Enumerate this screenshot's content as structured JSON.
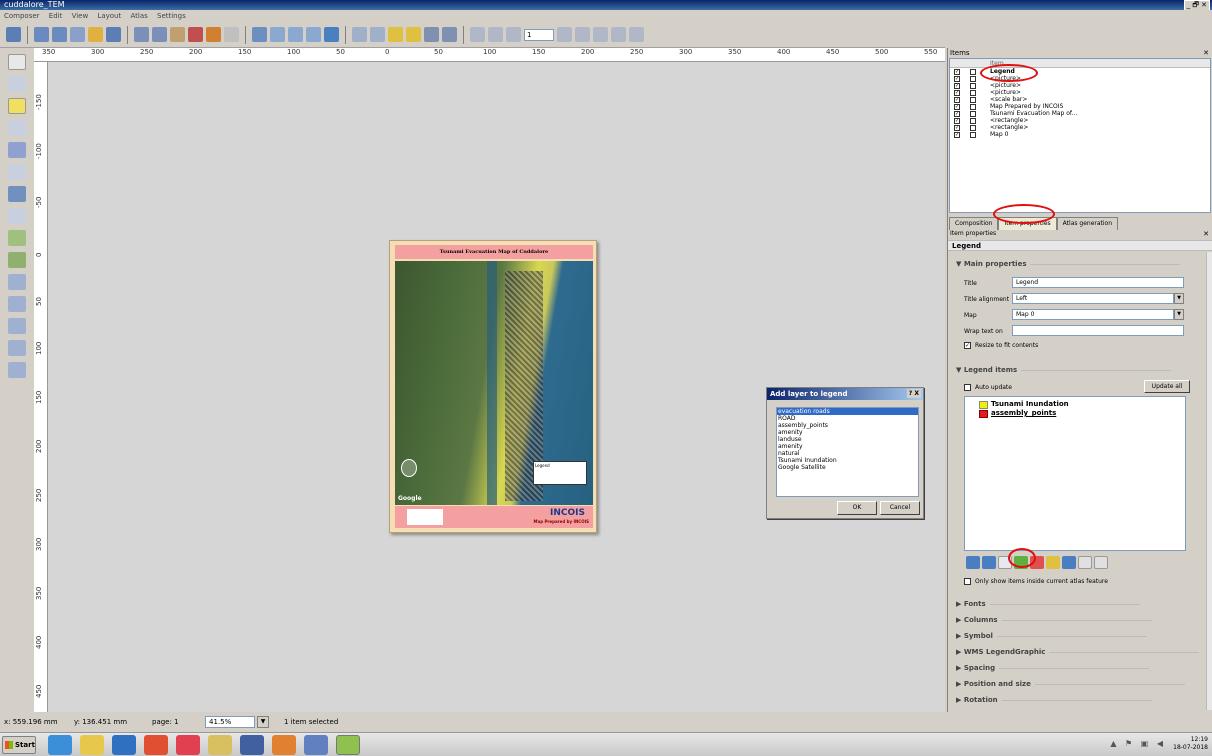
{
  "window": {
    "title": "cuddalore_TEM",
    "controls": "_ 🗗 ✕"
  },
  "menu": [
    "Composer",
    "Edit",
    "View",
    "Layout",
    "Atlas",
    "Settings"
  ],
  "toolbar": {
    "page_value": "1"
  },
  "ruler_top": [
    "350",
    "300",
    "250",
    "200",
    "150",
    "100",
    "50",
    "0",
    "50",
    "100",
    "150",
    "200",
    "250",
    "300",
    "350",
    "400",
    "450",
    "500",
    "550"
  ],
  "ruler_left": [
    "-150",
    "-100",
    "-50",
    "0",
    "50",
    "100",
    "150",
    "200",
    "250",
    "300",
    "350",
    "400",
    "450"
  ],
  "map_page": {
    "title": "Tsunami Evacuation Map of Cuddalore",
    "legend_box": "Legend",
    "google": "Google",
    "footer_logo": "INCOIS",
    "footer_text": "Map Prepared by INCOIS"
  },
  "dialog": {
    "title": "Add layer to legend",
    "title_buttons": "? X",
    "layers": [
      "evacuation roads",
      "ROAD",
      "assembly_points",
      "amenity",
      "landuse",
      "amenity",
      "natural",
      "Tsunami Inundation",
      "Google Satellite"
    ],
    "selected_index": 0,
    "ok": "OK",
    "cancel": "Cancel"
  },
  "status": {
    "x": "x: 559.196 mm",
    "y": "y: 136.451 mm",
    "page": "page: 1",
    "zoom": "41.5%",
    "selection": "1 item selected"
  },
  "items_panel": {
    "title": "Items",
    "header": "Item",
    "rows": [
      "Legend",
      "<picture>",
      "<picture>",
      "<picture>",
      "<scale bar>",
      "Map Prepared by INCOIS",
      "Tsunami Evacuation Map of...",
      "<rectangle>",
      "<rectangle>",
      "Map 0"
    ]
  },
  "tabs": [
    "Composition",
    "Item properties",
    "Atlas generation"
  ],
  "item_properties": {
    "panel_label": "Item properties",
    "heading": "Legend",
    "main_properties": "Main properties",
    "title_label": "Title",
    "title_value": "Legend",
    "title_alignment_label": "Title alignment",
    "title_alignment_value": "Left",
    "map_label": "Map",
    "map_value": "Map 0",
    "wrap_label": "Wrap text on",
    "resize_label": "Resize to fit contents",
    "legend_items": "Legend items",
    "auto_update": "Auto update",
    "update_all": "Update all",
    "legend_entries": [
      "Tsunami Inundation",
      "assembly_points"
    ],
    "only_show": "Only show items inside current atlas feature",
    "collapsed_sections": [
      "Fonts",
      "Columns",
      "Symbol",
      "WMS LegendGraphic",
      "Spacing",
      "Position and size",
      "Rotation"
    ]
  },
  "taskbar": {
    "start": "Start",
    "time": "12:19",
    "date": "18-07-2018"
  },
  "colors": {
    "title_bar": "#0a246a",
    "map_title_bg": "#f4a0a0",
    "page_bg": "#f5deb3",
    "annotation_red": "#e01010",
    "selection": "#316ac5"
  }
}
